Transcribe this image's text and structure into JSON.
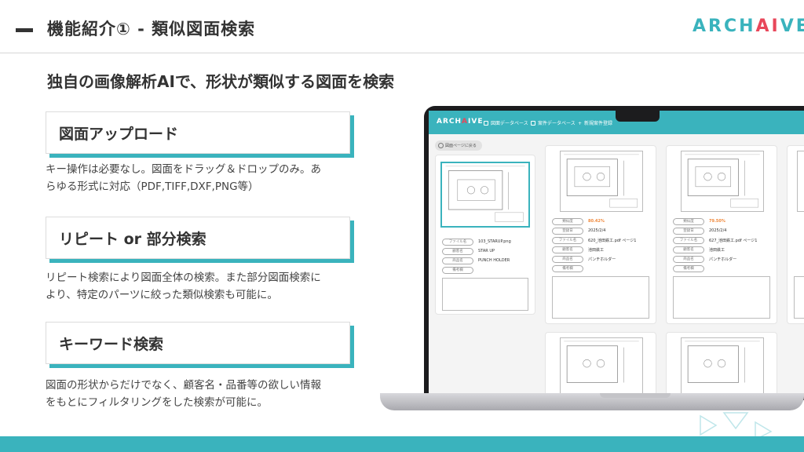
{
  "header": {
    "title": "機能紹介① - 類似図面検索",
    "logo_pre": "ARCH",
    "logo_ai": "AI",
    "logo_post": "VE"
  },
  "subtitle": "独自の画像解析AIで、形状が類似する図面を検索",
  "features": [
    {
      "label": "図面アップロード",
      "desc_1": "キー操作は必要なし。図面をドラッグ＆ドロップのみ。あ",
      "desc_2": "らゆる形式に対応（PDF,TIFF,DXF,PNG等）"
    },
    {
      "label": "リピート or  部分検索",
      "desc_1": "リピート検索により図面全体の検索。また部分図面検索に",
      "desc_2": "より、特定のパーツに絞った類似検索も可能に。"
    },
    {
      "label": "キーワード検索",
      "desc_1": "図面の形状からだけでなく、顧客名・品番等の欲しい情報",
      "desc_2": "をもとにフィルタリングをした検索が可能に。"
    }
  ],
  "app": {
    "logo_pre": "ARCH",
    "logo_ai": "A",
    "logo_post": "IVE",
    "nav": [
      "図面データベース",
      "案件データベース",
      "新規案件登録"
    ],
    "back": "図面ページに戻る",
    "query": {
      "fields": [
        {
          "k": "ファイル名",
          "v": "103_STARUP.png"
        },
        {
          "k": "顧客名",
          "v": "STAR UP"
        },
        {
          "k": "商品名",
          "v": "PUNCH HOLDER"
        },
        {
          "k": "備考欄",
          "v": ""
        }
      ]
    },
    "results": [
      {
        "fields": [
          {
            "k": "類似度",
            "v": "80.42%"
          },
          {
            "k": "登録日",
            "v": "2025/2/4"
          },
          {
            "k": "ファイル名",
            "v": "620_池田鉄工.pdf ページ1"
          },
          {
            "k": "顧客名",
            "v": "池田鉄工"
          },
          {
            "k": "商品名",
            "v": "パンチホルダー"
          },
          {
            "k": "備考欄",
            "v": ""
          }
        ]
      },
      {
        "fields": [
          {
            "k": "類似度",
            "v": "79.50%"
          },
          {
            "k": "登録日",
            "v": "2025/2/4"
          },
          {
            "k": "ファイル名",
            "v": "627_池田鉄工.pdf ページ1"
          },
          {
            "k": "顧客名",
            "v": "池田鉄工"
          },
          {
            "k": "商品名",
            "v": "パンチホルダー"
          },
          {
            "k": "備考欄",
            "v": ""
          }
        ]
      }
    ]
  },
  "colors": {
    "accent": "#3ab3bd",
    "ai_red": "#e8475a",
    "similarity": "#f0883a"
  }
}
